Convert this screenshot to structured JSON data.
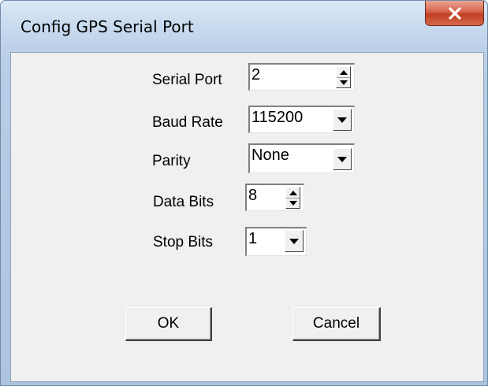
{
  "window": {
    "title": "Config GPS Serial Port"
  },
  "form": {
    "serial_port": {
      "label": "Serial Port",
      "value": "2"
    },
    "baud_rate": {
      "label": "Baud Rate",
      "value": "115200"
    },
    "parity": {
      "label": "Parity",
      "value": "None"
    },
    "data_bits": {
      "label": "Data Bits",
      "value": "8"
    },
    "stop_bits": {
      "label": "Stop Bits",
      "value": "1"
    }
  },
  "buttons": {
    "ok_label": "OK",
    "cancel_label": "Cancel"
  },
  "icons": {
    "close": "close-icon",
    "spin_up": "spin-up-arrow-icon",
    "spin_down": "spin-down-arrow-icon",
    "dropdown": "chevron-down-icon"
  },
  "colors": {
    "close_button": "#c9492c",
    "dialog_face": "#f0f0f0",
    "frame": "#b7cde6"
  }
}
